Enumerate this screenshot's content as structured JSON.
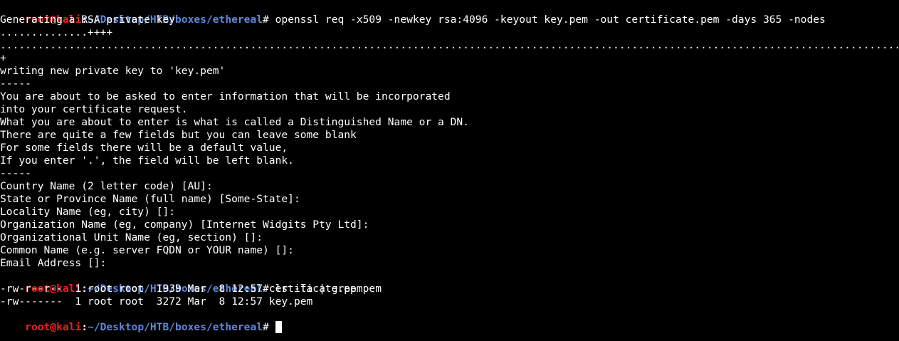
{
  "colors": {
    "background": "#000000",
    "text": "#ffffff",
    "prompt_user": "#ee2222",
    "prompt_path": "#5f87d7"
  },
  "prompt": {
    "user": "root@kali",
    "sep": ":",
    "path": "~/Desktop/HTB/boxes/ethereal",
    "symbol": "# "
  },
  "commands": {
    "openssl": "openssl req -x509 -newkey rsa:4096 -keyout key.pem -out certificate.pem -days 365 -nodes",
    "ls": "ls -la | grep pem"
  },
  "output": {
    "gen": "Generating a RSA private key",
    "dots1": "..............++++",
    "dots2": "..................................................................................................................................................+++",
    "dots3": "+",
    "writing": "writing new private key to 'key.pem'",
    "sep1": "-----",
    "info1": "You are about to be asked to enter information that will be incorporated",
    "info2": "into your certificate request.",
    "info3": "What you are about to enter is what is called a Distinguished Name or a DN.",
    "info4": "There are quite a few fields but you can leave some blank",
    "info5": "For some fields there will be a default value,",
    "info6": "If you enter '.', the field will be left blank.",
    "sep2": "-----",
    "country": "Country Name (2 letter code) [AU]:",
    "state": "State or Province Name (full name) [Some-State]:",
    "locality": "Locality Name (eg, city) []:",
    "org": "Organization Name (eg, company) [Internet Widgits Pty Ltd]:",
    "unit": "Organizational Unit Name (eg, section) []:",
    "common": "Common Name (e.g. server FQDN or YOUR name) []:",
    "email": "Email Address []:",
    "file1": "-rw-r--r--  1 root root  1939 Mar  8 12:57 certificate.pem",
    "file2": "-rw-------  1 root root  3272 Mar  8 12:57 key.pem"
  }
}
